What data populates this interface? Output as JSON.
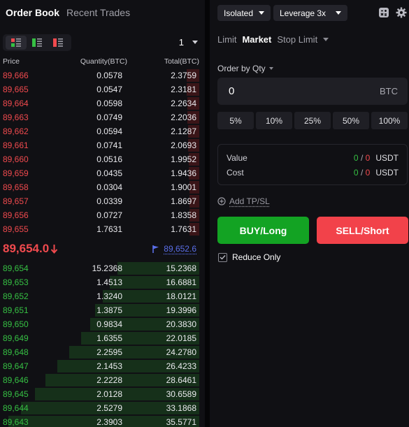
{
  "orderbook": {
    "tabs": [
      {
        "label": "Order Book",
        "active": true
      },
      {
        "label": "Recent Trades",
        "active": false
      }
    ],
    "precision": "1",
    "columns": {
      "price": "Price",
      "quantity": "Quantity(BTC)",
      "total": "Total(BTC)"
    },
    "asks": [
      {
        "price": "89,666",
        "qty": "0.0578",
        "total": "2.3759",
        "depth": 0.067
      },
      {
        "price": "89,665",
        "qty": "0.0547",
        "total": "2.3181",
        "depth": 0.065
      },
      {
        "price": "89,664",
        "qty": "0.0598",
        "total": "2.2634",
        "depth": 0.064
      },
      {
        "price": "89,663",
        "qty": "0.0749",
        "total": "2.2036",
        "depth": 0.062
      },
      {
        "price": "89,662",
        "qty": "0.0594",
        "total": "2.1287",
        "depth": 0.06
      },
      {
        "price": "89,661",
        "qty": "0.0741",
        "total": "2.0693",
        "depth": 0.058
      },
      {
        "price": "89,660",
        "qty": "0.0516",
        "total": "1.9952",
        "depth": 0.056
      },
      {
        "price": "89,659",
        "qty": "0.0435",
        "total": "1.9436",
        "depth": 0.055
      },
      {
        "price": "89,658",
        "qty": "0.0304",
        "total": "1.9001",
        "depth": 0.053
      },
      {
        "price": "89,657",
        "qty": "0.0339",
        "total": "1.8697",
        "depth": 0.053
      },
      {
        "price": "89,656",
        "qty": "0.0727",
        "total": "1.8358",
        "depth": 0.052
      },
      {
        "price": "89,655",
        "qty": "1.7631",
        "total": "1.7631",
        "depth": 0.05
      }
    ],
    "last_price": "89,654.0",
    "last_direction": "down",
    "mark_price": "89,652.6",
    "bids": [
      {
        "price": "89,654",
        "qty": "15.2368",
        "total": "15.2368",
        "depth": 0.428
      },
      {
        "price": "89,653",
        "qty": "1.4513",
        "total": "16.6881",
        "depth": 0.469
      },
      {
        "price": "89,652",
        "qty": "1.3240",
        "total": "18.0121",
        "depth": 0.506
      },
      {
        "price": "89,651",
        "qty": "1.3875",
        "total": "19.3996",
        "depth": 0.545
      },
      {
        "price": "89,650",
        "qty": "0.9834",
        "total": "20.3830",
        "depth": 0.573
      },
      {
        "price": "89,649",
        "qty": "1.6355",
        "total": "22.0185",
        "depth": 0.619
      },
      {
        "price": "89,648",
        "qty": "2.2595",
        "total": "24.2780",
        "depth": 0.682
      },
      {
        "price": "89,647",
        "qty": "2.1453",
        "total": "26.4233",
        "depth": 0.743
      },
      {
        "price": "89,646",
        "qty": "2.2228",
        "total": "28.6461",
        "depth": 0.805
      },
      {
        "price": "89,645",
        "qty": "2.0128",
        "total": "30.6589",
        "depth": 0.862
      },
      {
        "price": "89,644",
        "qty": "2.5279",
        "total": "33.1868",
        "depth": 0.933
      },
      {
        "price": "89,643",
        "qty": "2.3903",
        "total": "35.5771",
        "depth": 1.0
      }
    ]
  },
  "trade": {
    "margin_mode": "Isolated",
    "leverage": "Leverage 3x",
    "order_tabs": [
      {
        "label": "Limit",
        "active": false
      },
      {
        "label": "Market",
        "active": true
      },
      {
        "label": "Stop Limit",
        "active": false
      }
    ],
    "order_by": "Order by Qty",
    "qty_value": "0",
    "qty_unit": "BTC",
    "percents": [
      "5%",
      "10%",
      "25%",
      "50%",
      "100%"
    ],
    "value": {
      "label": "Value",
      "long": "0",
      "short": "0",
      "unit": "USDT"
    },
    "cost": {
      "label": "Cost",
      "long": "0",
      "short": "0",
      "unit": "USDT"
    },
    "tpsl_label": "Add TP/SL",
    "buy_label": "BUY/Long",
    "sell_label": "SELL/Short",
    "reduce_only_label": "Reduce Only",
    "reduce_only_checked": true
  },
  "colors": {
    "ask": "#f04a4e",
    "bid": "#36c043",
    "buy": "#13a323",
    "sell": "#f2424a",
    "mark": "#5a6ee8"
  }
}
